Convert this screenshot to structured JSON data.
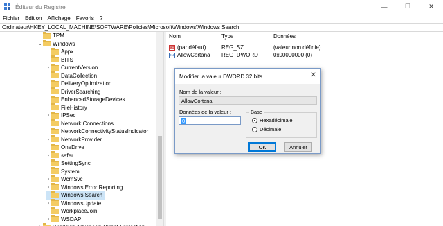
{
  "window": {
    "title": "Éditeur du Registre",
    "minimize": "—",
    "maximize": "☐",
    "close": "✕"
  },
  "menu": [
    "Fichier",
    "Edition",
    "Affichage",
    "Favoris",
    "?"
  ],
  "address": "Ordinateur\\HKEY_LOCAL_MACHINE\\SOFTWARE\\Policies\\Microsoft\\Windows\\Windows Search",
  "tree": [
    {
      "label": "TPM",
      "chevron": "",
      "indent": 1
    },
    {
      "label": "Windows",
      "chevron": "⌄",
      "indent": 1
    },
    {
      "label": "Appx",
      "chevron": "",
      "indent": 2
    },
    {
      "label": "BITS",
      "chevron": "",
      "indent": 2
    },
    {
      "label": "CurrentVersion",
      "chevron": "›",
      "indent": 2
    },
    {
      "label": "DataCollection",
      "chevron": "",
      "indent": 2
    },
    {
      "label": "DeliveryOptimization",
      "chevron": "",
      "indent": 2
    },
    {
      "label": "DriverSearching",
      "chevron": "",
      "indent": 2
    },
    {
      "label": "EnhancedStorageDevices",
      "chevron": "",
      "indent": 2
    },
    {
      "label": "FileHistory",
      "chevron": "",
      "indent": 2
    },
    {
      "label": "IPSec",
      "chevron": "›",
      "indent": 2
    },
    {
      "label": "Network Connections",
      "chevron": "",
      "indent": 2
    },
    {
      "label": "NetworkConnectivityStatusIndicator",
      "chevron": "",
      "indent": 2
    },
    {
      "label": "NetworkProvider",
      "chevron": "›",
      "indent": 2
    },
    {
      "label": "OneDrive",
      "chevron": "",
      "indent": 2
    },
    {
      "label": "safer",
      "chevron": "›",
      "indent": 2
    },
    {
      "label": "SettingSync",
      "chevron": "",
      "indent": 2
    },
    {
      "label": "System",
      "chevron": "",
      "indent": 2
    },
    {
      "label": "WcmSvc",
      "chevron": "›",
      "indent": 2
    },
    {
      "label": "Windows Error Reporting",
      "chevron": "›",
      "indent": 2
    },
    {
      "label": "Windows Search",
      "chevron": "",
      "indent": 2,
      "selected": true
    },
    {
      "label": "WindowsUpdate",
      "chevron": "›",
      "indent": 2
    },
    {
      "label": "WorkplaceJoin",
      "chevron": "",
      "indent": 2
    },
    {
      "label": "WSDAPI",
      "chevron": "›",
      "indent": 2
    },
    {
      "label": "Windows Advanced Threat Protection",
      "chevron": "›",
      "indent": 1
    }
  ],
  "list": {
    "headers": {
      "name": "Nom",
      "type": "Type",
      "data": "Données"
    },
    "rows": [
      {
        "icon": "string-value-icon",
        "name": "(par défaut)",
        "type": "REG_SZ",
        "data": "(valeur non définie)"
      },
      {
        "icon": "dword-value-icon",
        "name": "AllowCortana",
        "type": "REG_DWORD",
        "data": "0x00000000 (0)"
      }
    ]
  },
  "dialog": {
    "title": "Modifier la valeur DWORD 32 bits",
    "close": "✕",
    "name_label": "Nom de la valeur :",
    "name_value": "AllowCortana",
    "data_label": "Données de la valeur :",
    "data_value": "0",
    "base_label": "Base",
    "radio_hex": "Hexadécimale",
    "radio_dec": "Décimale",
    "selected_base": "Hexadécimale",
    "ok": "OK",
    "cancel": "Annuler"
  }
}
